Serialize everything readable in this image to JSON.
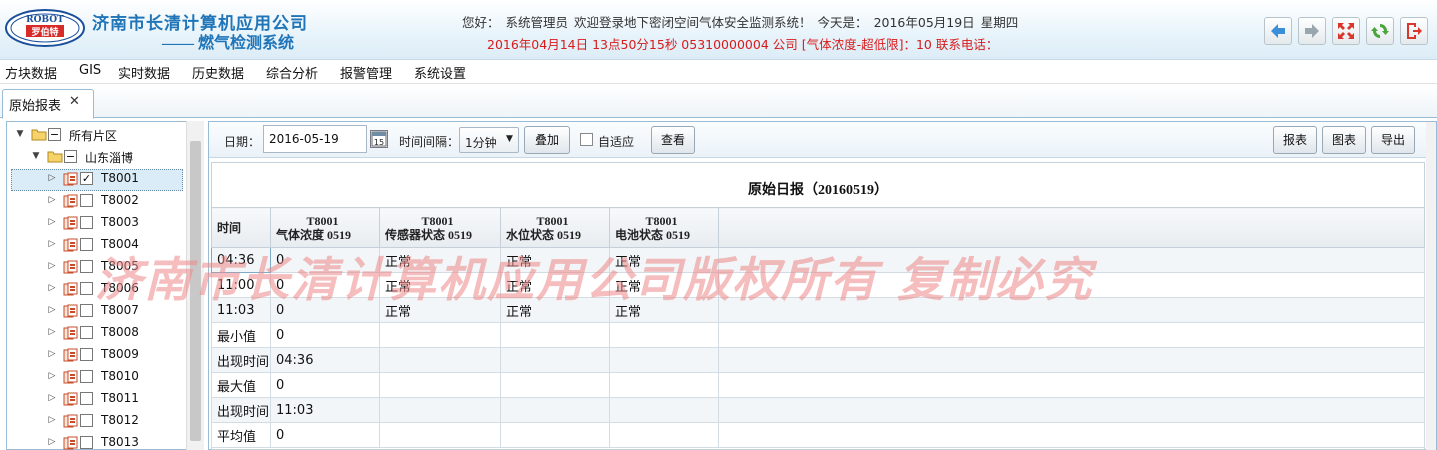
{
  "header": {
    "logo_top": "ROBOT",
    "logo_bottom": "罗伯特",
    "company": "济南市长清计算机应用公司",
    "subtitle": "—— 燃气检测系统",
    "greeting_label": "您好：",
    "user": "系统管理员",
    "welcome_msg": "欢迎登录地下密闭空间气体安全监测系统！",
    "today_label": "今天是：",
    "date": "2016年05月19日",
    "weekday": "星期四",
    "alarm_text": "2016年04月14日 13点50分15秒 05310000004 公司 [气体浓度-超低限]：10 联系电话："
  },
  "toolbar_buttons": [
    {
      "name": "back",
      "icon": "arrow-left-icon",
      "color": "#3b8fd8"
    },
    {
      "name": "forward",
      "icon": "arrow-right-icon",
      "color": "#9aa6ae"
    },
    {
      "name": "fullscreen",
      "icon": "expand-icon",
      "color": "#d9372b"
    },
    {
      "name": "refresh",
      "icon": "refresh-icon",
      "color": "#4aa63a"
    },
    {
      "name": "logout",
      "icon": "logout-icon",
      "color": "#d9372b"
    }
  ],
  "menu": [
    "方块数据",
    "GIS",
    "实时数据",
    "历史数据",
    "综合分析",
    "报警管理",
    "系统设置"
  ],
  "tab": {
    "label": "原始报表",
    "close": "✕"
  },
  "tree": {
    "root": "所有片区",
    "region": "山东淄博",
    "nodes": [
      {
        "label": "T8001",
        "checked": true
      },
      {
        "label": "T8002",
        "checked": false
      },
      {
        "label": "T8003",
        "checked": false
      },
      {
        "label": "T8004",
        "checked": false
      },
      {
        "label": "T8005",
        "checked": false
      },
      {
        "label": "T8006",
        "checked": false
      },
      {
        "label": "T8007",
        "checked": false
      },
      {
        "label": "T8008",
        "checked": false
      },
      {
        "label": "T8009",
        "checked": false
      },
      {
        "label": "T8010",
        "checked": false
      },
      {
        "label": "T8011",
        "checked": false
      },
      {
        "label": "T8012",
        "checked": false
      },
      {
        "label": "T8013",
        "checked": false
      }
    ]
  },
  "filters": {
    "date_label": "日期：",
    "date_value": "2016-05-19",
    "interval_label": "时间间隔：",
    "interval_value": "1分钟",
    "overlay_button": "叠加",
    "fit_label": "自适应",
    "view_button": "查看",
    "report_button": "报表",
    "chart_button": "图表",
    "export_button": "导出"
  },
  "report": {
    "title": "原始日报（20160519）",
    "time_header": "时间",
    "columns": [
      {
        "device": "T8001",
        "name": "气体浓度",
        "code": "0519"
      },
      {
        "device": "T8001",
        "name": "传感器状态",
        "code": "0519"
      },
      {
        "device": "T8001",
        "name": "水位状态",
        "code": "0519"
      },
      {
        "device": "T8001",
        "name": "电池状态",
        "code": "0519"
      }
    ],
    "rows": [
      [
        "04:36",
        "0",
        "正常",
        "正常",
        "正常"
      ],
      [
        "11:00",
        "0",
        "正常",
        "正常",
        "正常"
      ],
      [
        "11:03",
        "0",
        "正常",
        "正常",
        "正常"
      ],
      [
        "最小值",
        "0",
        "",
        "",
        ""
      ],
      [
        "出现时间",
        "04:36",
        "",
        "",
        ""
      ],
      [
        "最大值",
        "0",
        "",
        "",
        ""
      ],
      [
        "出现时间",
        "11:03",
        "",
        "",
        ""
      ],
      [
        "平均值",
        "0",
        "",
        "",
        ""
      ]
    ]
  },
  "watermark": "济南市长清计算机应用公司版权所有 复制必究"
}
